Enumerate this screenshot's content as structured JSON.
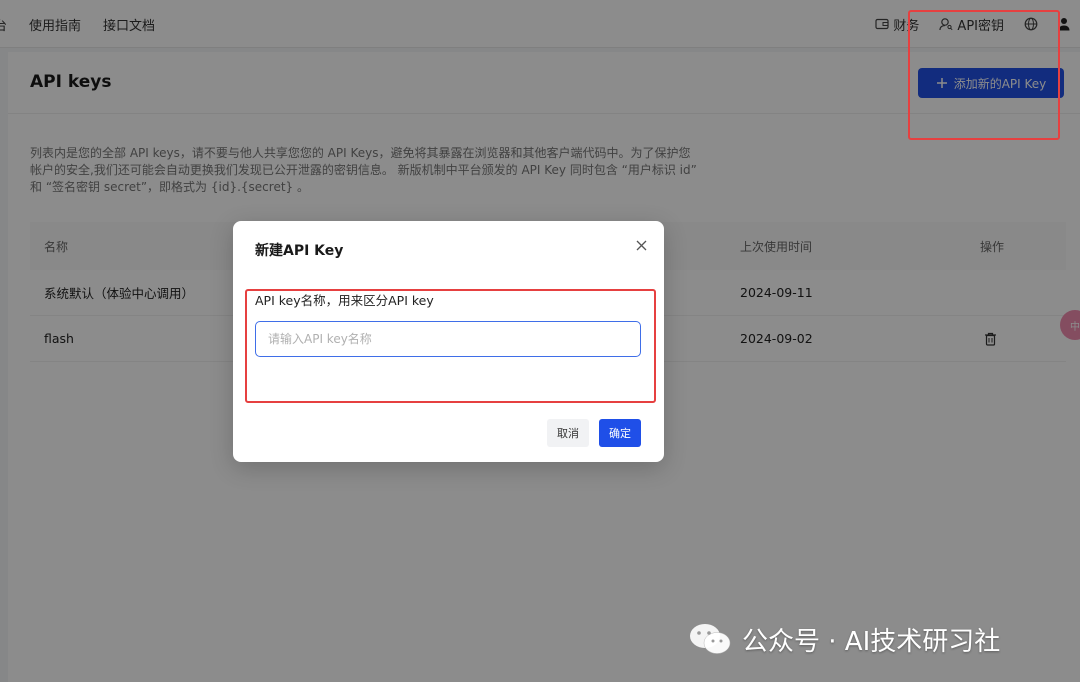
{
  "nav": {
    "left_items": [
      "台",
      "使用指南",
      "接口文档"
    ],
    "right": {
      "finance": "财务",
      "api_keys": "API密钥"
    },
    "icons": [
      "wallet-icon",
      "key-user-icon",
      "globe-icon",
      "user-icon"
    ]
  },
  "page": {
    "title": "API keys",
    "add_button": "添加新的API Key",
    "description": "列表内是您的全部 API keys，请不要与他人共享您您的 API Keys，避免将其暴露在浏览器和其他客户端代码中。为了保护您帐户的安全,我们还可能会自动更换我们发现已公开泄露的密钥信息。 新版机制中平台颁发的 API Key 同时包含 “用户标识 id” 和 “签名密钥 secret”，即格式为 {id}.{secret} 。"
  },
  "table": {
    "headers": {
      "name": "名称",
      "last_used": "上次使用时间",
      "action": "操作"
    },
    "rows": [
      {
        "name": "系统默认（体验中心调用）",
        "last_used": "2024-09-11"
      },
      {
        "name": "flash",
        "last_used": "2024-09-02"
      }
    ]
  },
  "side_float": "中",
  "dialog": {
    "title": "新建API Key",
    "label": "API key名称，用来区分API key",
    "input_placeholder": "请输入API key名称",
    "input_value": "",
    "cancel": "取消",
    "ok": "确定"
  },
  "watermark": "公众号 · AI技术研习社",
  "colors": {
    "primary": "#2151e6",
    "highlight_border": "#e64040",
    "overlay": "rgba(0,0,0,0.45)"
  }
}
